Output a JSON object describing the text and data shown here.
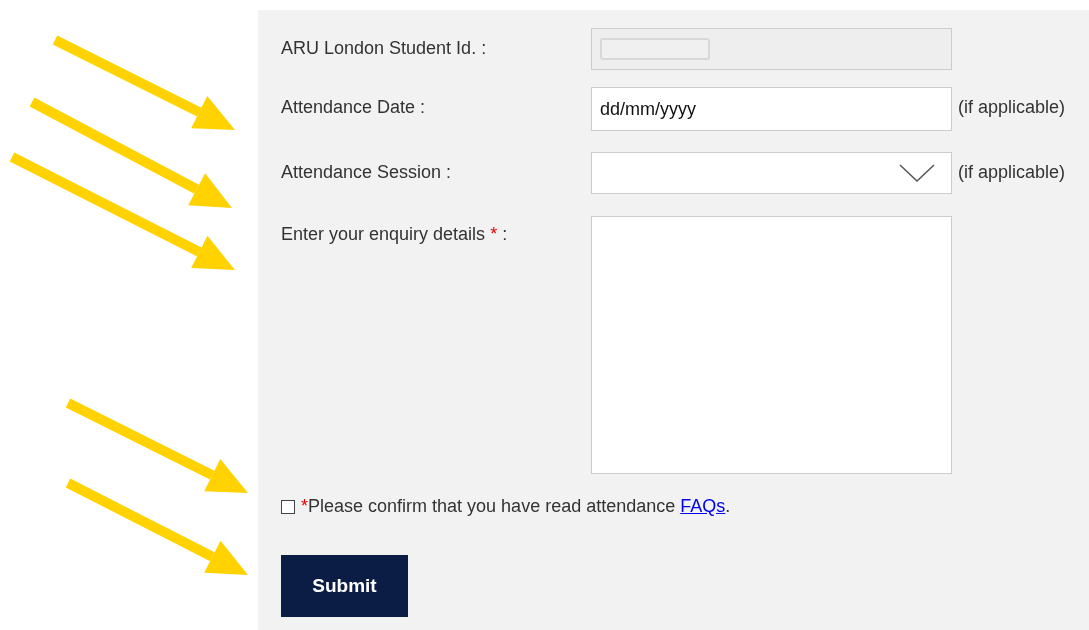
{
  "form": {
    "fields": [
      {
        "kind": "locked",
        "label": "ARU London Student Id. :"
      },
      {
        "kind": "date",
        "label": "Attendance Date :",
        "value": "dd/mm/yyyy",
        "note": "(if applicable)"
      },
      {
        "kind": "select",
        "label": "Attendance Session :",
        "note": "(if applicable)"
      },
      {
        "kind": "textarea",
        "label": "Enter your enquiry details",
        "required_mark": "*",
        "label_end": ":"
      }
    ],
    "confirm": {
      "checked": false,
      "required_mark": "*",
      "text": "Please confirm that you have read attendance ",
      "link": "FAQs",
      "end": "."
    },
    "submit": "Submit"
  }
}
